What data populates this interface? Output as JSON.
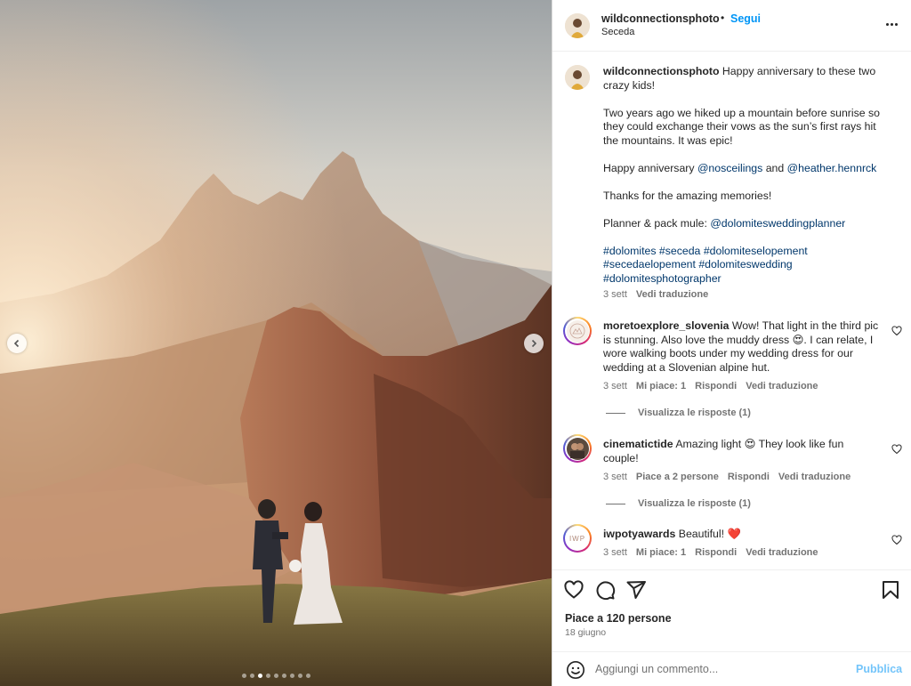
{
  "header": {
    "username": "wildconnectionsphoto",
    "separator": "•",
    "follow_label": "Segui",
    "location": "Seceda",
    "more_icon": "more-horizontal-icon"
  },
  "caption": {
    "username": "wildconnectionsphoto",
    "line1": "Happy anniversary to these two crazy kids!",
    "para2": "Two years ago we hiked up a mountain before sunrise so they could exchange their vows as the sun’s first rays hit the mountains. It was epic!",
    "para3_prefix": "Happy anniversary",
    "mention1": "@nosceilings",
    "para3_and": "and",
    "mention2": "@heather.hennrck",
    "para4": "Thanks for the amazing memories!",
    "para5_prefix": "Planner & pack mule:",
    "mention3": "@dolomitesweddingplanner",
    "hashtags_line1": [
      "#dolomites",
      "#seceda",
      "#dolomiteselopement"
    ],
    "hashtags_line2": [
      "#secedaelopement",
      "#dolomiteswedding"
    ],
    "hashtags_line3": [
      "#dolomitesphotographer"
    ],
    "time": "3 sett",
    "translate": "Vedi traduzione"
  },
  "comments": [
    {
      "username": "moretoexplore_slovenia",
      "text": "Wow! That light in the third pic is stunning. Also love the muddy dress 😍. I can relate, I wore walking boots under my wedding dress for our wedding at a Slovenian alpine hut.",
      "time": "3 sett",
      "likes": "Mi piace: 1",
      "reply": "Rispondi",
      "translate": "Vedi traduzione",
      "view_replies": "Visualizza le risposte (1)"
    },
    {
      "username": "cinematictide",
      "text": "Amazing light 😍 They look like fun couple!",
      "time": "3 sett",
      "likes": "Piace a 2 persone",
      "reply": "Rispondi",
      "translate": "Vedi traduzione",
      "view_replies": "Visualizza le risposte (1)"
    },
    {
      "username": "iwpotyawards",
      "text": "Beautiful! ❤️",
      "time": "3 sett",
      "likes": "Mi piace: 1",
      "reply": "Rispondi",
      "translate": "Vedi traduzione",
      "avatar_text": "IWP"
    }
  ],
  "actions": {
    "likes_text": "Piace a 120 persone",
    "date": "18 giugno"
  },
  "add_comment": {
    "placeholder": "Aggiungi un commento...",
    "publish": "Pubblica"
  },
  "carousel": {
    "slide_count": 9,
    "active_index": 2
  },
  "colors": {
    "accent_blue": "#0095f6",
    "link_blue": "#00376b",
    "muted": "#737373"
  }
}
